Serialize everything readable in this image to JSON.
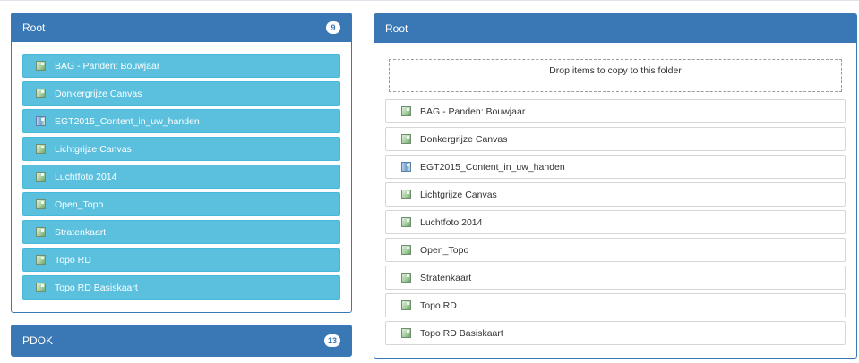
{
  "left_panel": {
    "title": "Root",
    "count": "9",
    "items": [
      {
        "label": "BAG - Panden: Bouwjaar",
        "icon": "map-layer-icon"
      },
      {
        "label": "Donkergrijze Canvas",
        "icon": "map-layer-icon"
      },
      {
        "label": "EGT2015_Content_in_uw_handen",
        "icon": "map-layer-alt-icon"
      },
      {
        "label": "Lichtgrijze Canvas",
        "icon": "map-layer-icon"
      },
      {
        "label": "Luchtfoto 2014",
        "icon": "map-layer-icon"
      },
      {
        "label": "Open_Topo",
        "icon": "map-layer-icon"
      },
      {
        "label": "Stratenkaart",
        "icon": "map-layer-icon"
      },
      {
        "label": "Topo RD",
        "icon": "map-layer-icon"
      },
      {
        "label": "Topo RD Basiskaart",
        "icon": "map-layer-icon"
      }
    ]
  },
  "pdok_panel": {
    "title": "PDOK",
    "count": "13"
  },
  "right_panel": {
    "title": "Root",
    "drop_zone_text": "Drop items to copy to this folder",
    "items": [
      {
        "label": "BAG - Panden: Bouwjaar",
        "icon": "map-layer-icon"
      },
      {
        "label": "Donkergrijze Canvas",
        "icon": "map-layer-icon"
      },
      {
        "label": "EGT2015_Content_in_uw_handen",
        "icon": "map-layer-alt-icon"
      },
      {
        "label": "Lichtgrijze Canvas",
        "icon": "map-layer-icon"
      },
      {
        "label": "Luchtfoto 2014",
        "icon": "map-layer-icon"
      },
      {
        "label": "Open_Topo",
        "icon": "map-layer-icon"
      },
      {
        "label": "Stratenkaart",
        "icon": "map-layer-icon"
      },
      {
        "label": "Topo RD",
        "icon": "map-layer-icon"
      },
      {
        "label": "Topo RD Basiskaart",
        "icon": "map-layer-icon"
      }
    ]
  },
  "colors": {
    "panel_header": "#3a78b5",
    "item_bg": "#5bc0de",
    "badge_bg": "#ffffff"
  }
}
